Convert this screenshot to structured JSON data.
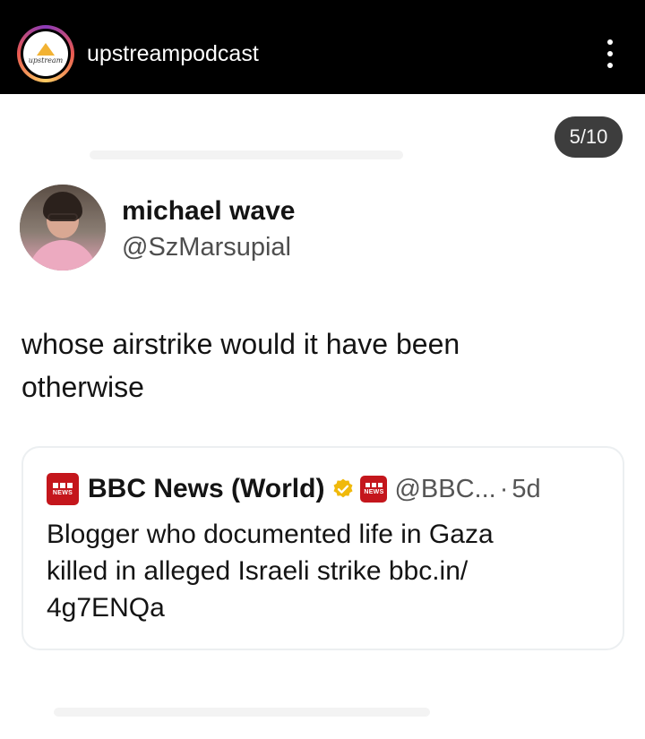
{
  "header": {
    "account_name": "upstreampodcast",
    "avatar_logo_text": "upstream",
    "more_icon": "more-vertical-icon"
  },
  "post": {
    "slide_counter": "5/10",
    "author": {
      "display_name": "michael wave",
      "handle": "@SzMarsupial"
    },
    "text_line1": "whose airstrike would it have been",
    "text_line2": "otherwise",
    "quote": {
      "source_name": "BBC News (World)",
      "source_handle": "@BBC...",
      "separator": "·",
      "age": "5d",
      "logo_icon": "bbc-news-logo-icon",
      "logo_text": "NEWS",
      "verified_icon": "gold-verified-badge-icon",
      "verified_color": "#f0b90b",
      "text_line1": "Blogger who documented life in Gaza",
      "text_line2": "killed in alleged Israeli strike bbc.in/",
      "text_line3": "4g7ENQa"
    }
  },
  "colors": {
    "topbar": "#000000",
    "bbc_red": "#c4161c",
    "counter_bg": "#3d3d3d"
  }
}
